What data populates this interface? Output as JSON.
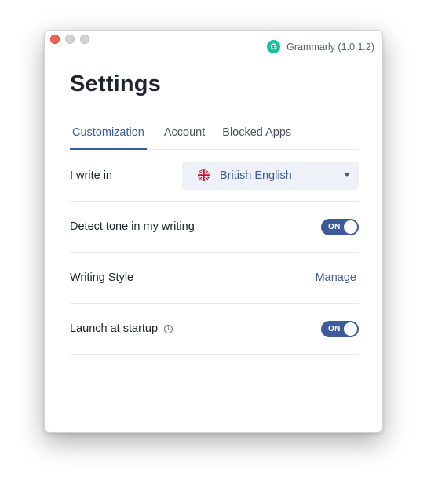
{
  "app": {
    "name_version": "Grammarly (1.0.1.2)",
    "logo_letter": "G",
    "brand_color": "#15c39a"
  },
  "page": {
    "title": "Settings"
  },
  "tabs": [
    {
      "label": "Customization",
      "active": true
    },
    {
      "label": "Account",
      "active": false
    },
    {
      "label": "Blocked Apps",
      "active": false
    }
  ],
  "settings": {
    "language": {
      "label": "I write in",
      "value": "British English",
      "icon": "uk-flag-icon"
    },
    "tone": {
      "label": "Detect tone in my writing",
      "toggle": "ON"
    },
    "style": {
      "label": "Writing Style",
      "action": "Manage"
    },
    "startup": {
      "label": "Launch at startup",
      "info_icon": "i",
      "toggle": "ON"
    }
  },
  "colors": {
    "accent": "#3d5a99",
    "close": "#ec5f57"
  }
}
